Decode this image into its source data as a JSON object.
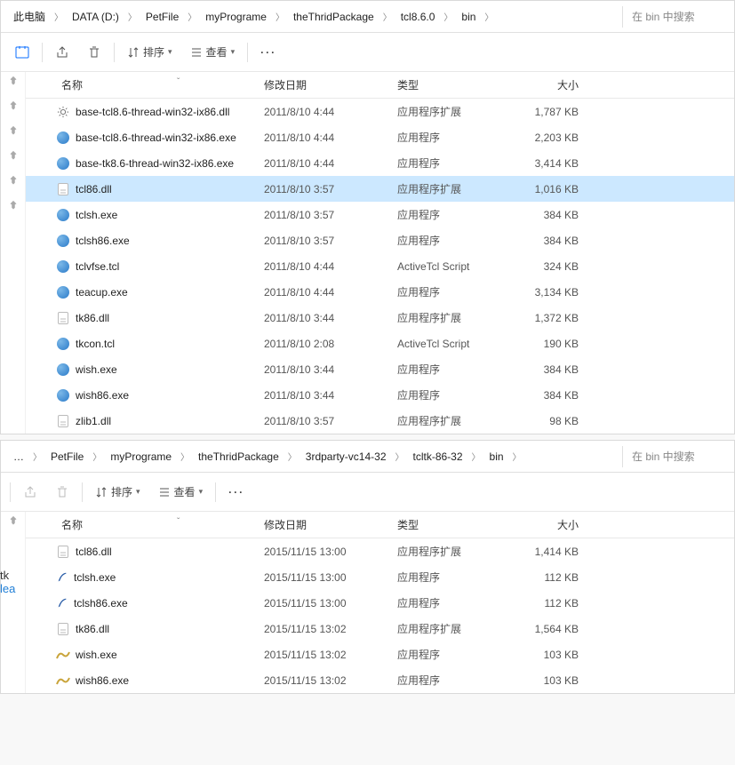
{
  "win1": {
    "breadcrumb": [
      "此电脑",
      "DATA (D:)",
      "PetFile",
      "myPrograme",
      "theThridPackage",
      "tcl8.6.0",
      "bin"
    ],
    "search_placeholder": "在 bin 中搜索",
    "sort_label": "排序",
    "view_label": "查看",
    "columns": {
      "name": "名称",
      "date": "修改日期",
      "type": "类型",
      "size": "大小"
    },
    "selected_index": 3,
    "files": [
      {
        "icon": "gear",
        "name": "base-tcl8.6-thread-win32-ix86.dll",
        "date": "2011/8/10 4:44",
        "type": "应用程序扩展",
        "size": "1,787 KB"
      },
      {
        "icon": "exe",
        "name": "base-tcl8.6-thread-win32-ix86.exe",
        "date": "2011/8/10 4:44",
        "type": "应用程序",
        "size": "2,203 KB"
      },
      {
        "icon": "exe",
        "name": "base-tk8.6-thread-win32-ix86.exe",
        "date": "2011/8/10 4:44",
        "type": "应用程序",
        "size": "3,414 KB"
      },
      {
        "icon": "dll",
        "name": "tcl86.dll",
        "date": "2011/8/10 3:57",
        "type": "应用程序扩展",
        "size": "1,016 KB"
      },
      {
        "icon": "exe",
        "name": "tclsh.exe",
        "date": "2011/8/10 3:57",
        "type": "应用程序",
        "size": "384 KB"
      },
      {
        "icon": "exe",
        "name": "tclsh86.exe",
        "date": "2011/8/10 3:57",
        "type": "应用程序",
        "size": "384 KB"
      },
      {
        "icon": "exe",
        "name": "tclvfse.tcl",
        "date": "2011/8/10 4:44",
        "type": "ActiveTcl Script",
        "size": "324 KB"
      },
      {
        "icon": "exe",
        "name": "teacup.exe",
        "date": "2011/8/10 4:44",
        "type": "应用程序",
        "size": "3,134 KB"
      },
      {
        "icon": "dll",
        "name": "tk86.dll",
        "date": "2011/8/10 3:44",
        "type": "应用程序扩展",
        "size": "1,372 KB"
      },
      {
        "icon": "exe",
        "name": "tkcon.tcl",
        "date": "2011/8/10 2:08",
        "type": "ActiveTcl Script",
        "size": "190 KB"
      },
      {
        "icon": "exe",
        "name": "wish.exe",
        "date": "2011/8/10 3:44",
        "type": "应用程序",
        "size": "384 KB"
      },
      {
        "icon": "exe",
        "name": "wish86.exe",
        "date": "2011/8/10 3:44",
        "type": "应用程序",
        "size": "384 KB"
      },
      {
        "icon": "dll",
        "name": "zlib1.dll",
        "date": "2011/8/10 3:57",
        "type": "应用程序扩展",
        "size": "98 KB"
      }
    ]
  },
  "win2": {
    "breadcrumb_prefix": "…",
    "breadcrumb": [
      "PetFile",
      "myPrograme",
      "theThridPackage",
      "3rdparty-vc14-32",
      "tcltk-86-32",
      "bin"
    ],
    "search_placeholder": "在 bin 中搜索",
    "sort_label": "排序",
    "view_label": "查看",
    "columns": {
      "name": "名称",
      "date": "修改日期",
      "type": "类型",
      "size": "大小"
    },
    "selected_index": -1,
    "files": [
      {
        "icon": "dll",
        "name": "tcl86.dll",
        "date": "2015/11/15 13:00",
        "type": "应用程序扩展",
        "size": "1,414 KB"
      },
      {
        "icon": "feather",
        "name": "tclsh.exe",
        "date": "2015/11/15 13:00",
        "type": "应用程序",
        "size": "112 KB"
      },
      {
        "icon": "feather",
        "name": "tclsh86.exe",
        "date": "2015/11/15 13:00",
        "type": "应用程序",
        "size": "112 KB"
      },
      {
        "icon": "dll",
        "name": "tk86.dll",
        "date": "2015/11/15 13:02",
        "type": "应用程序扩展",
        "size": "1,564 KB"
      },
      {
        "icon": "wish",
        "name": "wish.exe",
        "date": "2015/11/15 13:02",
        "type": "应用程序",
        "size": "103 KB"
      },
      {
        "icon": "wish",
        "name": "wish86.exe",
        "date": "2015/11/15 13:02",
        "type": "应用程序",
        "size": "103 KB"
      }
    ]
  },
  "side_fragments": {
    "tk": "tk",
    "lea": "lea"
  }
}
